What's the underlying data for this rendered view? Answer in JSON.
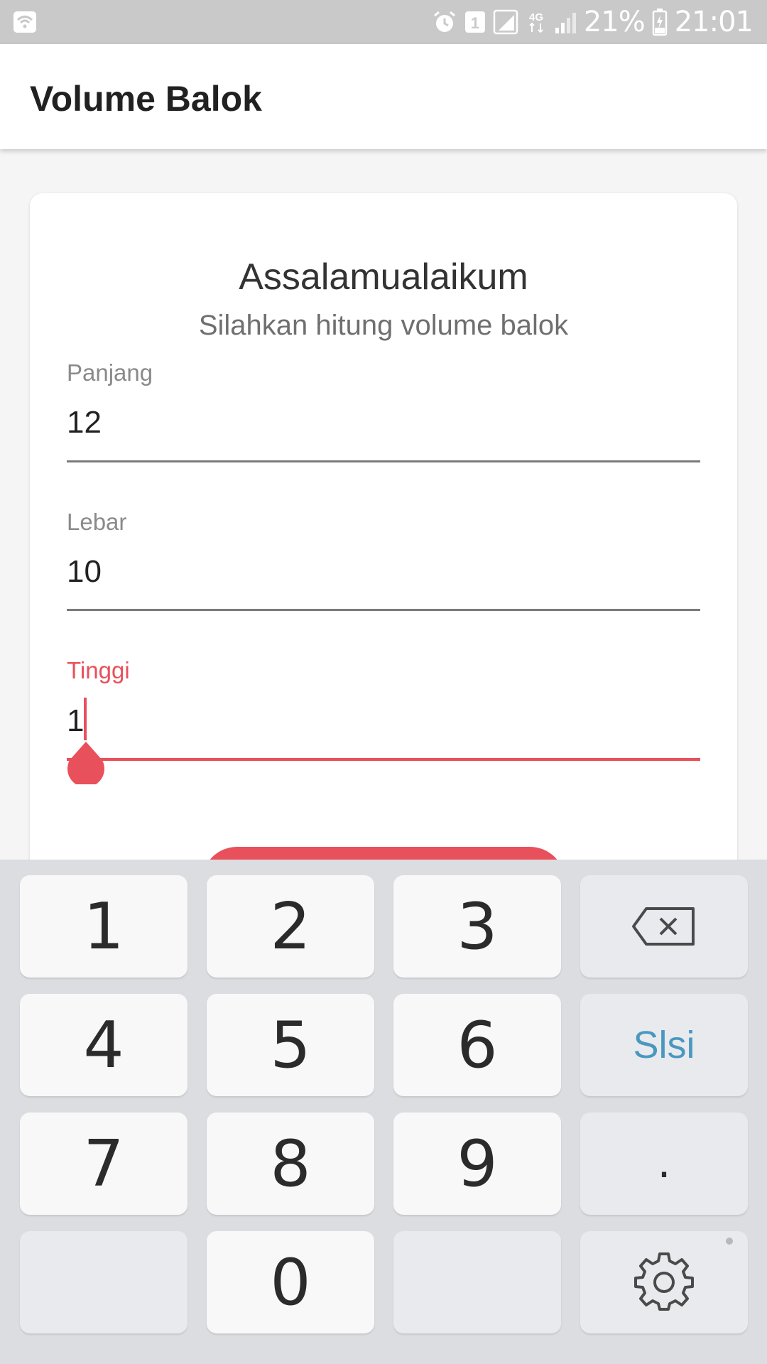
{
  "status_bar": {
    "battery": "21%",
    "time": "21:01",
    "sim_badge": "1",
    "network": "4G",
    "icons": [
      "wifi-icon",
      "alarm-icon",
      "sim-badge-icon",
      "signal-icon",
      "network-4g-icon",
      "signal-icon",
      "battery-charging-icon"
    ]
  },
  "app_bar": {
    "title": "Volume Balok"
  },
  "card": {
    "greeting": "Assalamualaikum",
    "subtitle": "Silahkan hitung volume balok",
    "fields": [
      {
        "label": "Panjang",
        "value": "12"
      },
      {
        "label": "Lebar",
        "value": "10"
      },
      {
        "label": "Tinggi",
        "value": "1",
        "focused": true
      }
    ]
  },
  "colors": {
    "accent": "#e8505b",
    "statusbar": "#c9c9c9",
    "keyboard_bg": "#dcdde1",
    "key_bg": "#f8f8f8",
    "done_text": "#4a98c0"
  },
  "keyboard": {
    "keys": {
      "k1": "1",
      "k2": "2",
      "k3": "3",
      "k4": "4",
      "k5": "5",
      "k6": "6",
      "k7": "7",
      "k8": "8",
      "k9": "9",
      "k0": "0",
      "done": "Slsi",
      "decimal": "."
    },
    "icons": {
      "backspace": "backspace-icon",
      "settings": "gear-icon"
    }
  }
}
